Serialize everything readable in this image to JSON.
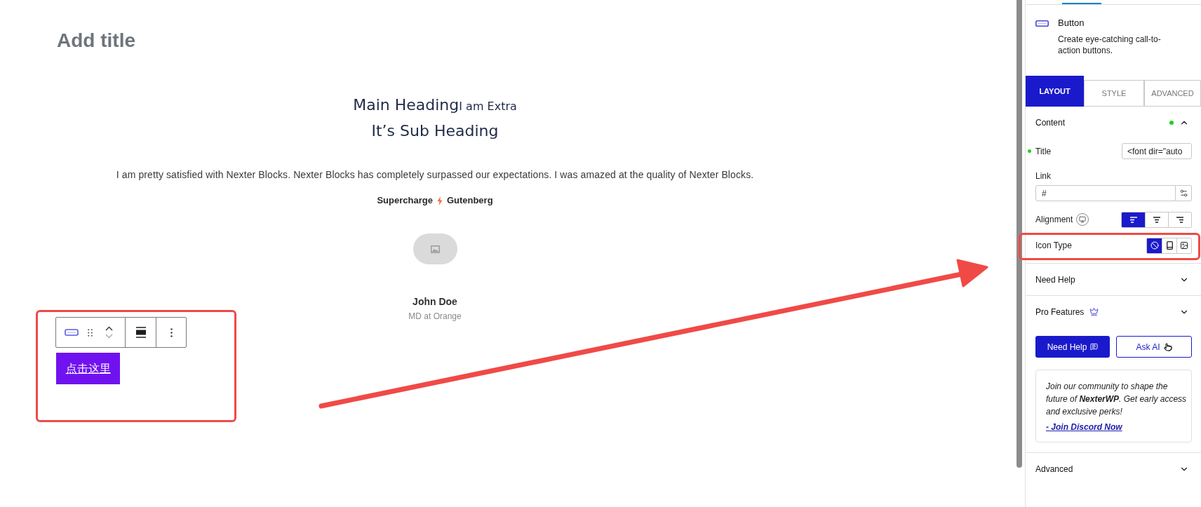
{
  "title_field": {
    "placeholder": "Add title"
  },
  "content": {
    "heading": "Main Heading",
    "heading_extra": "I am Extra",
    "sub_heading": "It’s Sub Heading",
    "paragraph": "I am pretty satisfied with Nexter Blocks. Nexter Blocks has completely surpassed our expectations. I was amazed at the quality of Nexter Blocks.",
    "tagline": [
      "Supercharge",
      "Gutenberg"
    ],
    "testimonial": {
      "name": "John Doe",
      "role": "MD at Orange"
    }
  },
  "selected_block": {
    "button_label": "点击这里"
  },
  "sidebar": {
    "block": {
      "name": "Button",
      "description": "Create eye-catching call-to-action buttons."
    },
    "tabs": [
      {
        "label": "LAYOUT",
        "selected": true
      },
      {
        "label": "STYLE",
        "selected": false
      },
      {
        "label": "ADVANCED",
        "selected": false
      }
    ],
    "sections": [
      {
        "kind": "panel",
        "title": "Content",
        "expanded": true,
        "modified": true,
        "pro": false,
        "fields": [
          {
            "kind": "text",
            "label": "Title",
            "value": "<font dir=\"auto",
            "modified": true
          },
          {
            "kind": "link",
            "label": "Link",
            "value": "#",
            "modified": false
          },
          {
            "kind": "align",
            "label": "Alignment",
            "modified": false,
            "options": [
              {
                "selected": true
              },
              {
                "selected": false
              },
              {
                "selected": false
              }
            ]
          },
          {
            "kind": "icons",
            "label": "Icon Type",
            "modified": false,
            "options": [
              {
                "selected": true
              },
              {
                "selected": false
              },
              {
                "selected": false
              }
            ]
          }
        ]
      },
      {
        "kind": "panel",
        "title": "Need Help",
        "expanded": false,
        "modified": false,
        "pro": false
      },
      {
        "kind": "panel",
        "title": "Pro Features",
        "expanded": false,
        "modified": false,
        "pro": true
      },
      {
        "kind": "help",
        "buttons": [
          {
            "label": "Need Help",
            "primary": true
          },
          {
            "label": "Ask AI",
            "primary": false
          }
        ],
        "note": "Join our community to shape the future of **NexterWP**. Get early access and exclusive perks!",
        "link": "- Join Discord Now"
      },
      {
        "kind": "panel",
        "title": "Advanced",
        "expanded": false,
        "modified": false,
        "pro": false
      }
    ]
  }
}
